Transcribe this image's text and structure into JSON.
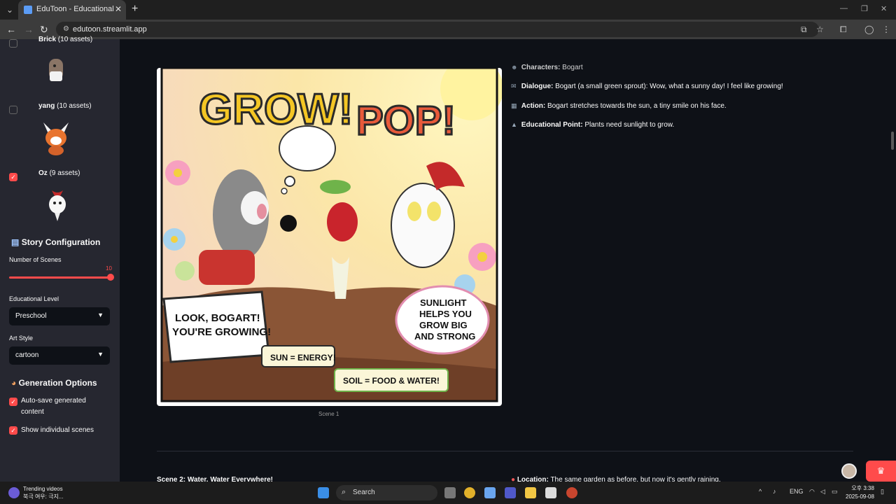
{
  "browser": {
    "tab_title": "EduToon - Educational Webtoon",
    "url": "edutoon.streamlit.app"
  },
  "sidebar": {
    "characters": [
      {
        "name": "Brick",
        "assets": "(10 assets)",
        "checked": false
      },
      {
        "name": "yang",
        "assets": "(10 assets)",
        "checked": false
      },
      {
        "name": "Oz",
        "assets": "(9 assets)",
        "checked": true
      }
    ],
    "story_config_title": "Story Configuration",
    "num_scenes_label": "Number of Scenes",
    "num_scenes_value": "10",
    "num_scenes_fraction": 1.0,
    "edu_level_label": "Educational Level",
    "edu_level_value": "Preschool",
    "art_style_label": "Art Style",
    "art_style_value": "cartoon",
    "gen_options_title": "Generation Options",
    "autosave_label": "Auto-save generated content",
    "show_scenes_label": "Show individual scenes"
  },
  "main": {
    "scene1": {
      "caption": "Scene 1",
      "characters_label": "Characters:",
      "characters_value": "Bogart",
      "dialogue_label": "Dialogue:",
      "dialogue_value": "Bogart (a small green sprout): Wow, what a sunny day! I feel like growing!",
      "action_label": "Action:",
      "action_value": "Bogart stretches towards the sun, a tiny smile on his face.",
      "edu_label": "Educational Point:",
      "edu_value": "Plants need sunlight to grow."
    },
    "comic": {
      "title_grow": "GROW!",
      "title_pop": "POP!",
      "bubble_left": "LOOK, BOGART! YOU'RE GROWING!",
      "bubble_right": "SUNLIGHT HELPS YOU GROW BIG AND STRONG",
      "label_sun": "SUN = ENERGY!",
      "label_soil": "SOIL = FOOD & WATER!"
    },
    "scene2_title": "Scene 2: Water, Water Everywhere!",
    "scene2_location_label": "Location:",
    "scene2_location_value": "The same garden as before, but now it's gently raining."
  },
  "taskbar": {
    "trending_title": "Trending videos",
    "trending_sub": "북극 여우: 극지...",
    "search_label": "Search",
    "lang": "ENG",
    "time": "오후 3:38",
    "date": "2025-09-08"
  },
  "colors": {
    "accent": "#ff4b4b",
    "sidebar_bg": "#262730",
    "main_bg": "#0e1117"
  }
}
